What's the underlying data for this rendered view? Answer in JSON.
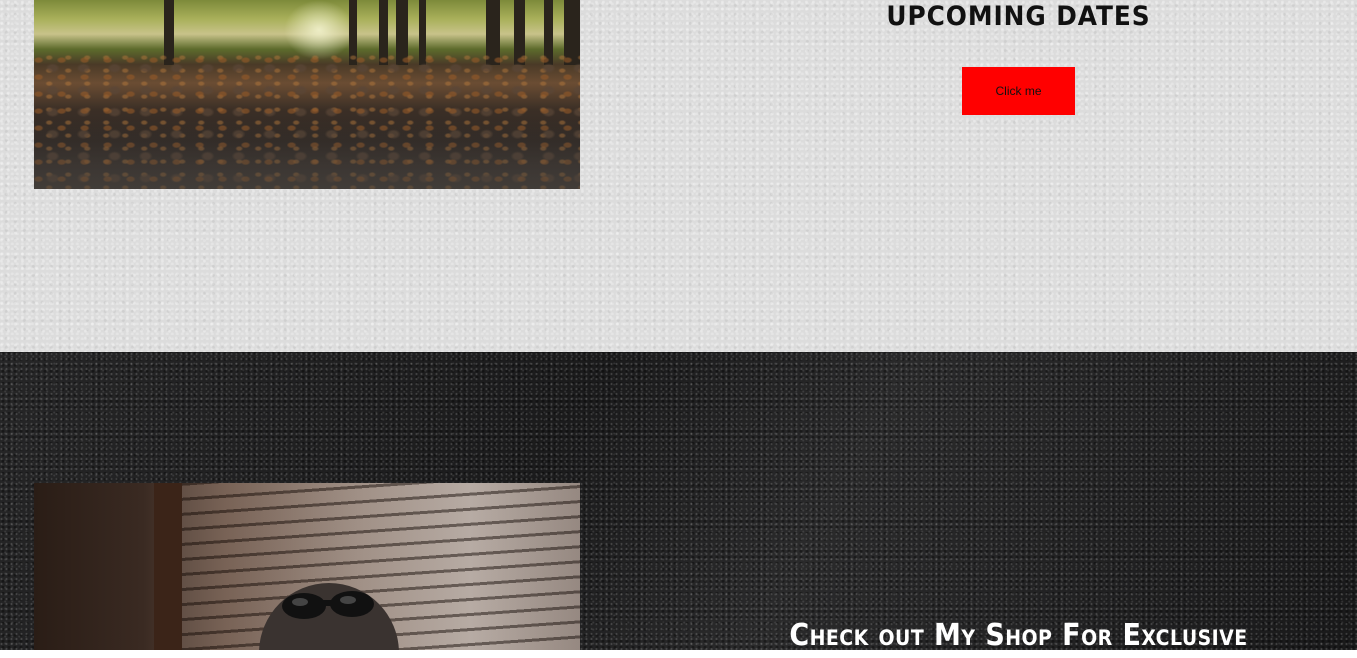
{
  "upcoming": {
    "title": "Upcoming Dates",
    "button_label": "Click me",
    "button_color": "#ff0000",
    "image_alt": "forest path photo"
  },
  "shop": {
    "title": "Check out My Shop For Exclusive",
    "image_alt": "portrait photo with goggles"
  },
  "colors": {
    "light_section_bg": "#dcdcdc",
    "dark_section_bg": "#1f1f20"
  }
}
